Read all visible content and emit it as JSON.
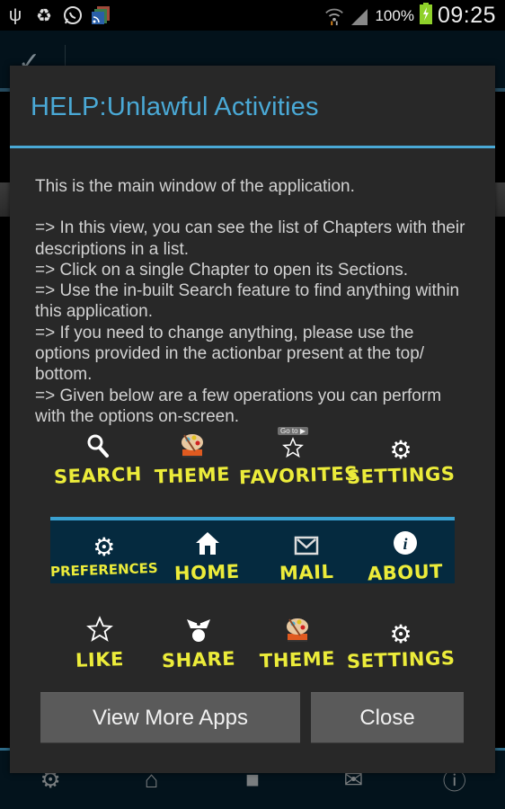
{
  "status_bar": {
    "left_icons": [
      "usb-icon",
      "recycle-icon",
      "whatsapp-icon",
      "rss-reader-icon"
    ],
    "right_icons": [
      "wifi-icon",
      "signal-icon"
    ],
    "battery_percent": "100%",
    "battery_icon": "battery-charging-icon",
    "time": "09:25"
  },
  "background_app": {
    "actionbar_icon": "checkmark-icon",
    "bottom_bar_icons": [
      "gear-icon",
      "home-icon",
      "android-icon",
      "mail-icon",
      "info-icon"
    ]
  },
  "dialog": {
    "title": "HELP:Unlawful Activities",
    "intro": "This is the main window of the application.",
    "bullets": [
      " => In this view, you can see the list of Chapters with their descriptions in a list.",
      " => Click on a single Chapter to open its Sections.",
      " => Use the in-built Search feature to find anything within this application.",
      " => If you need to change anything, please use the options provided in the actionbar present at the top/ bottom.",
      " => Given below are a few operations you can perform with the options on-screen."
    ],
    "row1": [
      {
        "label": "SEARCH",
        "icon": "search-icon"
      },
      {
        "label": "THEME",
        "icon": "palette-icon"
      },
      {
        "label": "FAVORITES",
        "icon": "star-icon",
        "badge": "Go to ▶"
      },
      {
        "label": "SETTINGS",
        "icon": "gear-icon"
      }
    ],
    "row2": [
      {
        "label": "PREFERENCES",
        "icon": "gear-icon"
      },
      {
        "label": "HOME",
        "icon": "home-icon"
      },
      {
        "label": "MAIL",
        "icon": "mail-icon"
      },
      {
        "label": "ABOUT",
        "icon": "info-icon"
      }
    ],
    "row3": [
      {
        "label": "LIKE",
        "icon": "star-icon"
      },
      {
        "label": "SHARE",
        "icon": "share-icon"
      },
      {
        "label": "THEME",
        "icon": "palette-icon"
      },
      {
        "label": "SETTINGS",
        "icon": "gear-icon"
      }
    ],
    "buttons": {
      "view_more": "View More Apps",
      "close": "Close"
    },
    "colors": {
      "accent": "#4aa9d6",
      "label_yellow": "#ecec3a",
      "dialog_bg": "#282828",
      "button_bg": "#5a5a5a"
    }
  }
}
